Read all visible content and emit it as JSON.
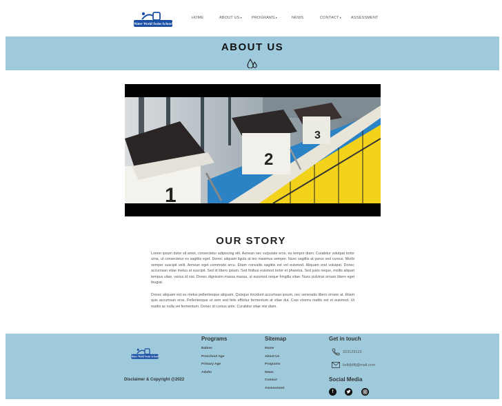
{
  "header": {
    "logo_text": "Water World Swim School",
    "nav": [
      {
        "label": "HOME",
        "has_caret": false
      },
      {
        "label": "ABOUT US",
        "has_caret": true
      },
      {
        "label": "PROGRAMS",
        "has_caret": true
      },
      {
        "label": "NEWS",
        "has_caret": false
      },
      {
        "label": "CONTACT",
        "has_caret": true
      },
      {
        "label": "ASSESSMENT",
        "has_caret": false
      }
    ],
    "caret": "▾"
  },
  "banner": {
    "title": "ABOUT US",
    "icon": "water-drops-icon"
  },
  "hero": {
    "icon": "swimming-starting-blocks-image",
    "block_numbers": [
      "1",
      "2",
      "3"
    ]
  },
  "story": {
    "title": "OUR STORY",
    "paragraph1": "Lorem ipsum dolor sit amet, consectetur adipiscing elit. Aenean nec vulputate eros, eu tempor diam. Curabitur volutpat tortor urna, ut consectetur ex sagittis eget. Donec aliquam ligula at leo maximus semper. Nunc sagittis at purus sed cursus. Morbi semper suscipit velit. Aenean eget commodo arcu. Etiam convallis sagittis est vel euismod. Aliquam erat volutpat. Donec accumsan vitae metus at suscipit. Sed id libero ipsum. Sed finibus euismod tortor et pharetra. Sed justo neque, mollis aliquet tempus vitae, varius id nisi. Donec dignissim massa massa, ut euismod neque fringilla vitae. Nunc pulvinar ornare libero eget feugiat.",
    "paragraph2": "Donec aliquam est eu metus pellentesque aliquam. Quisque tincidunt accumsan ipsum, nec venenatis libero ornare at. Etiam quis accumsan eros. Pellentesque ut sem sed felis efficitur fermentum at vitae dui. Cras viverra mattis est et euismod. Ut mattis ac nulla vel fermentum. Donec id cursus ante. Curabitur vitae nisi diam."
  },
  "footer": {
    "disclaimer": "Disclaimer & Copyright @2022",
    "programs": {
      "title": "Programs",
      "links": [
        "Babies",
        "Preschool Age",
        "Primary Age",
        "Adults"
      ]
    },
    "sitemap": {
      "title": "Sitemap",
      "links": [
        "Home",
        "About Us",
        "Programs",
        "News",
        "Contact",
        "Assessment"
      ]
    },
    "contact": {
      "title": "Get in touch",
      "phone": "323123123",
      "email": "lsdkfjdlfj@mail.com",
      "social_title": "Social Media",
      "social_icons": [
        "facebook-icon",
        "twitter-icon",
        "instagram-icon"
      ]
    }
  },
  "colors": {
    "band": "#9fcadc",
    "logo_blue": "#1a4fa3",
    "lane_yellow": "#f2d21a",
    "pool_blue": "#2b83c6"
  }
}
